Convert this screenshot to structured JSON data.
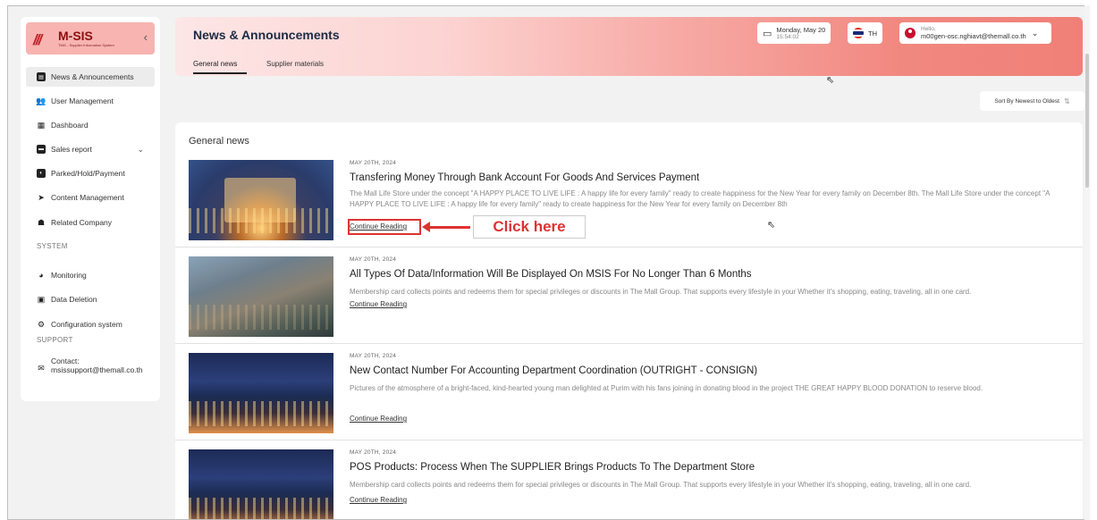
{
  "sidebar": {
    "logo_mark": "///",
    "logo_text": "M-SIS",
    "logo_sub": "TMG - Supplier Information System",
    "collapse_icon": "chevron-left-icon",
    "items": [
      {
        "label": "News & Announcements",
        "icon": "newspaper-icon"
      },
      {
        "label": "User Management",
        "icon": "users-icon"
      },
      {
        "label": "Dashboard",
        "icon": "dashboard-icon"
      },
      {
        "label": "Sales report",
        "icon": "folder-icon"
      },
      {
        "label": "Parked/Hold/Payment",
        "icon": "payment-icon"
      },
      {
        "label": "Content Management",
        "icon": "send-icon"
      },
      {
        "label": "Related Company",
        "icon": "company-icon"
      }
    ],
    "system_label": "SYSTEM",
    "system_items": [
      {
        "label": "Monitoring",
        "icon": "monitor-icon"
      },
      {
        "label": "Data Deletion",
        "icon": "delete-icon"
      },
      {
        "label": "Configuration system",
        "icon": "config-icon"
      }
    ],
    "support_label": "SUPPORT",
    "contact_label": "Contact:",
    "contact_email": "msissupport@themall.co.th"
  },
  "header": {
    "title": "News & Announcements",
    "tabs": [
      {
        "label": "General news"
      },
      {
        "label": "Supplier materials"
      }
    ],
    "date": "Monday, May 20",
    "time": "15:54:02",
    "language": "TH",
    "greeting": "Hello,",
    "user_email": "m00gen-osc.nghiavt@themall.co.th"
  },
  "sort": {
    "label": "Sort By Newest to Oldest"
  },
  "content": {
    "section_title": "General news",
    "continue_label": "Continue Reading",
    "news": [
      {
        "date": "MAY 20TH, 2024",
        "title": "Transfering Money Through Bank Account For Goods And Services Payment",
        "desc": "The Mall Life Store under the concept \"A HAPPY PLACE TO LIVE LIFE : A happy life for every family\" ready to create happiness for the New Year for every family on December 8th. The Mall Life Store under the concept \"A HAPPY PLACE TO LIVE LIFE : A happy life for every family\" ready to create happiness for the New Year for every family on December 8th"
      },
      {
        "date": "MAY 20TH, 2024",
        "title": "All Types Of Data/Information Will Be Displayed On MSIS For No Longer Than 6 Months",
        "desc": "Membership card collects points and redeems them for special privileges or discounts in The Mall Group. That supports every lifestyle in your Whether it's shopping, eating, traveling, all in one card."
      },
      {
        "date": "MAY 20TH, 2024",
        "title": "New Contact Number For Accounting Department Coordination (OUTRIGHT - CONSIGN)",
        "desc": "Pictures of the atmosphere of a bright-faced, kind-hearted young man delighted at Purim with his fans joining in donating blood in the project THE GREAT HAPPY BLOOD DONATION to reserve blood."
      },
      {
        "date": "MAY 20TH, 2024",
        "title": "POS Products: Process When The SUPPLIER Brings Products To The Department Store",
        "desc": "Membership card collects points and redeems them for special privileges or discounts in The Mall Group. That supports every lifestyle in your Whether it's shopping, eating, traveling, all in one card."
      }
    ]
  },
  "annotation": {
    "callout_text": "Click here",
    "color": "#dd3333"
  }
}
